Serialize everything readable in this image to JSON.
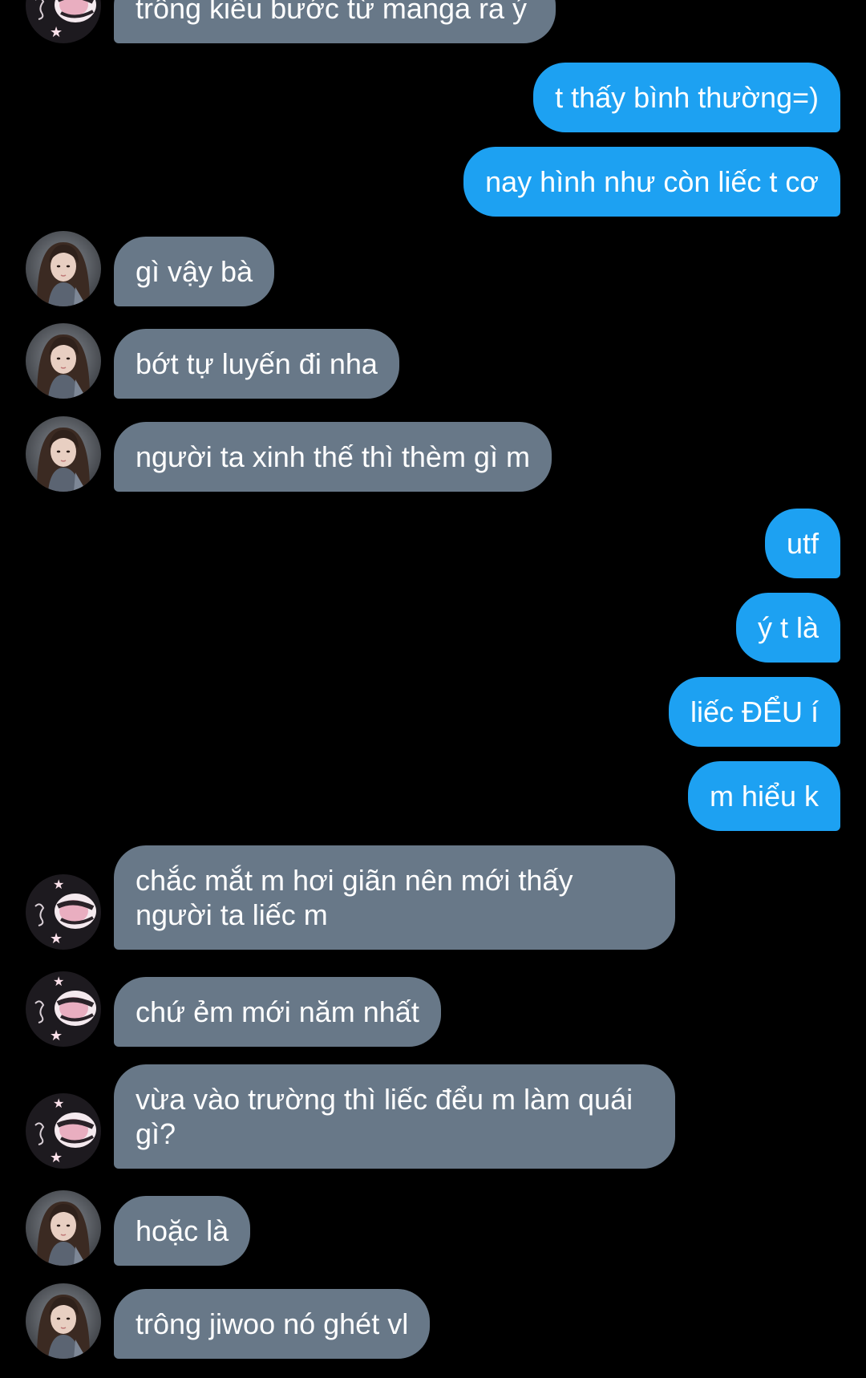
{
  "colors": {
    "background": "#000000",
    "incoming_bubble": "#687888",
    "outgoing_bubble": "#1da1f2",
    "text": "#ffffff"
  },
  "messages": [
    {
      "dir": "in",
      "avatar": "bw-pink-avatar-icon",
      "text": "trông kiểu bước từ manga ra ý"
    },
    {
      "dir": "out",
      "text": "t thấy bình thường=)"
    },
    {
      "dir": "out",
      "text": "nay hình như còn liếc t cơ"
    },
    {
      "dir": "in",
      "avatar": "girl-photo-avatar-icon",
      "text": "gì vậy bà"
    },
    {
      "dir": "in",
      "avatar": "girl-photo-avatar-icon",
      "text": "bớt tự luyến đi nha"
    },
    {
      "dir": "in",
      "avatar": "girl-photo-avatar-icon",
      "text": "người ta xinh thế thì thèm gì m"
    },
    {
      "dir": "out",
      "text": "utf"
    },
    {
      "dir": "out",
      "text": "ý t là"
    },
    {
      "dir": "out",
      "text": "liếc ĐỂU í"
    },
    {
      "dir": "out",
      "text": "m hiểu k"
    },
    {
      "dir": "in",
      "avatar": "bw-pink-avatar-icon",
      "text": "chắc mắt m hơi giãn nên mới thấy người ta liếc m"
    },
    {
      "dir": "in",
      "avatar": "bw-pink-avatar-icon",
      "text": "chứ ẻm mới năm nhất"
    },
    {
      "dir": "in",
      "avatar": "bw-pink-avatar-icon",
      "text": "vừa vào trường thì liếc đểu m làm quái gì?"
    },
    {
      "dir": "in",
      "avatar": "girl-photo-avatar-icon",
      "text": "hoặc là"
    },
    {
      "dir": "in",
      "avatar": "girl-photo-avatar-icon",
      "text": "trông jiwoo nó ghét vl"
    }
  ]
}
